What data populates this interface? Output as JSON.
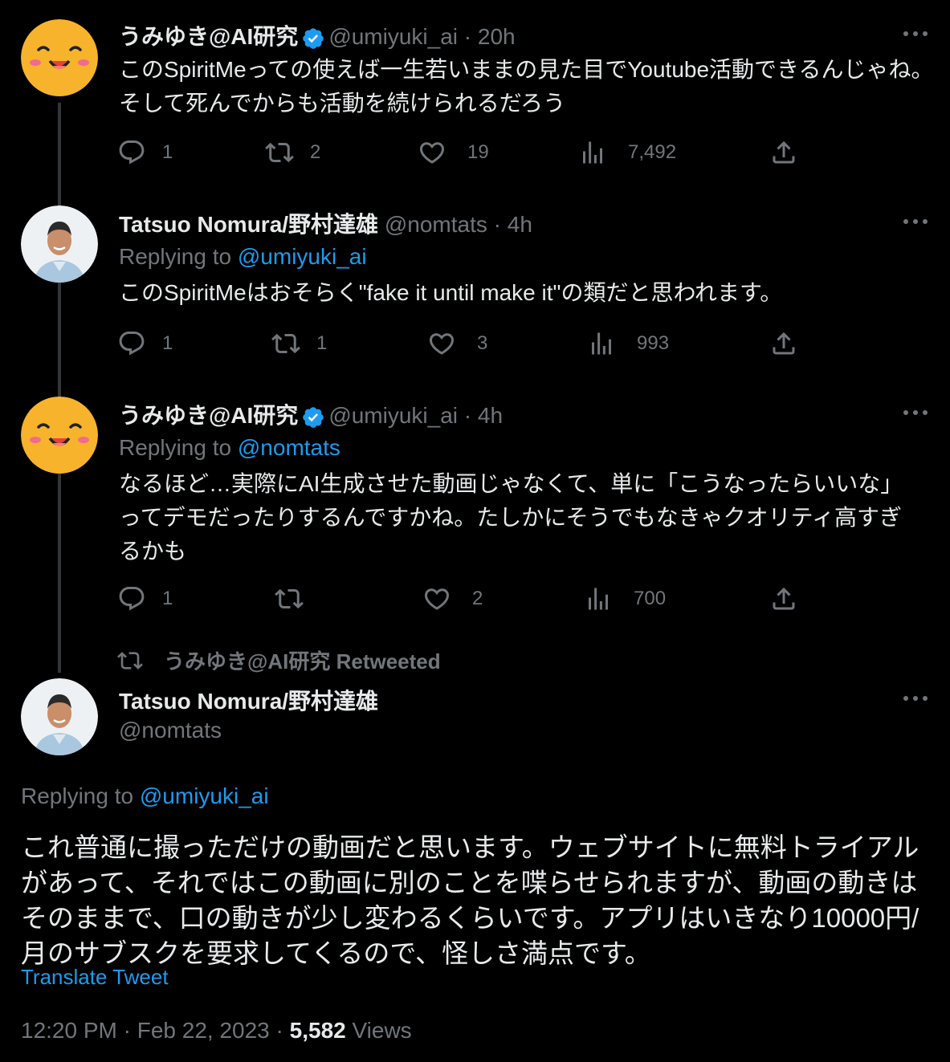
{
  "tweets": [
    {
      "display_name": "うみゆき@AI研究",
      "handle": "@umiyuki_ai",
      "time": "20h",
      "replying_to": "",
      "text": "このSpiritMeっての使えば一生若いままの見た目でYoutube活動できるんじゃね。そして死んでからも活動を続けられるだろう",
      "replies": "1",
      "retweets": "2",
      "likes": "19",
      "views": "7,492"
    },
    {
      "display_name": "Tatsuo Nomura/野村達雄",
      "handle": "@nomtats",
      "time": "4h",
      "replying_to_label": "Replying to",
      "replying_to": "@umiyuki_ai",
      "text": "このSpiritMeはおそらく\"fake it until make it\"の類だと思われます。",
      "replies": "1",
      "retweets": "1",
      "likes": "3",
      "views": "993"
    },
    {
      "display_name": "うみゆき@AI研究",
      "handle": "@umiyuki_ai",
      "time": "4h",
      "replying_to_label": "Replying to",
      "replying_to": "@nomtats",
      "text": "なるほど…実際にAI生成させた動画じゃなくて、単に「こうなったらいいな」ってデモだったりするんですかね。たしかにそうでもなきゃクオリティ高すぎるかも",
      "replies": "1",
      "retweets": "",
      "likes": "2",
      "views": "700"
    }
  ],
  "retweet_banner": "うみゆき@AI研究 Retweeted",
  "main_tweet": {
    "display_name": "Tatsuo Nomura/野村達雄",
    "handle": "@nomtats",
    "replying_to_label": "Replying to",
    "replying_to": "@umiyuki_ai",
    "text": "これ普通に撮っただけの動画だと思います。ウェブサイトに無料トライアルがあって、それではこの動画に別のことを喋らせられますが、動画の動きはそのままで、口の動きが少し変わるくらいです。アプリはいきなり10000円/月のサブスクを要求してくるので、怪しさ満点です。",
    "translate": "Translate Tweet",
    "timestamp": "12:20 PM · Feb 22, 2023 · ",
    "views_count": "5,582",
    "views_label": " Views"
  },
  "colors": {
    "background": "#000000",
    "text": "#e7e9ea",
    "muted": "#71767b",
    "accent": "#1d9bf0",
    "thread_line": "#333639"
  },
  "icons": [
    "reply-icon",
    "retweet-icon",
    "like-icon",
    "views-icon",
    "share-icon",
    "more-icon",
    "verified-badge-icon"
  ]
}
